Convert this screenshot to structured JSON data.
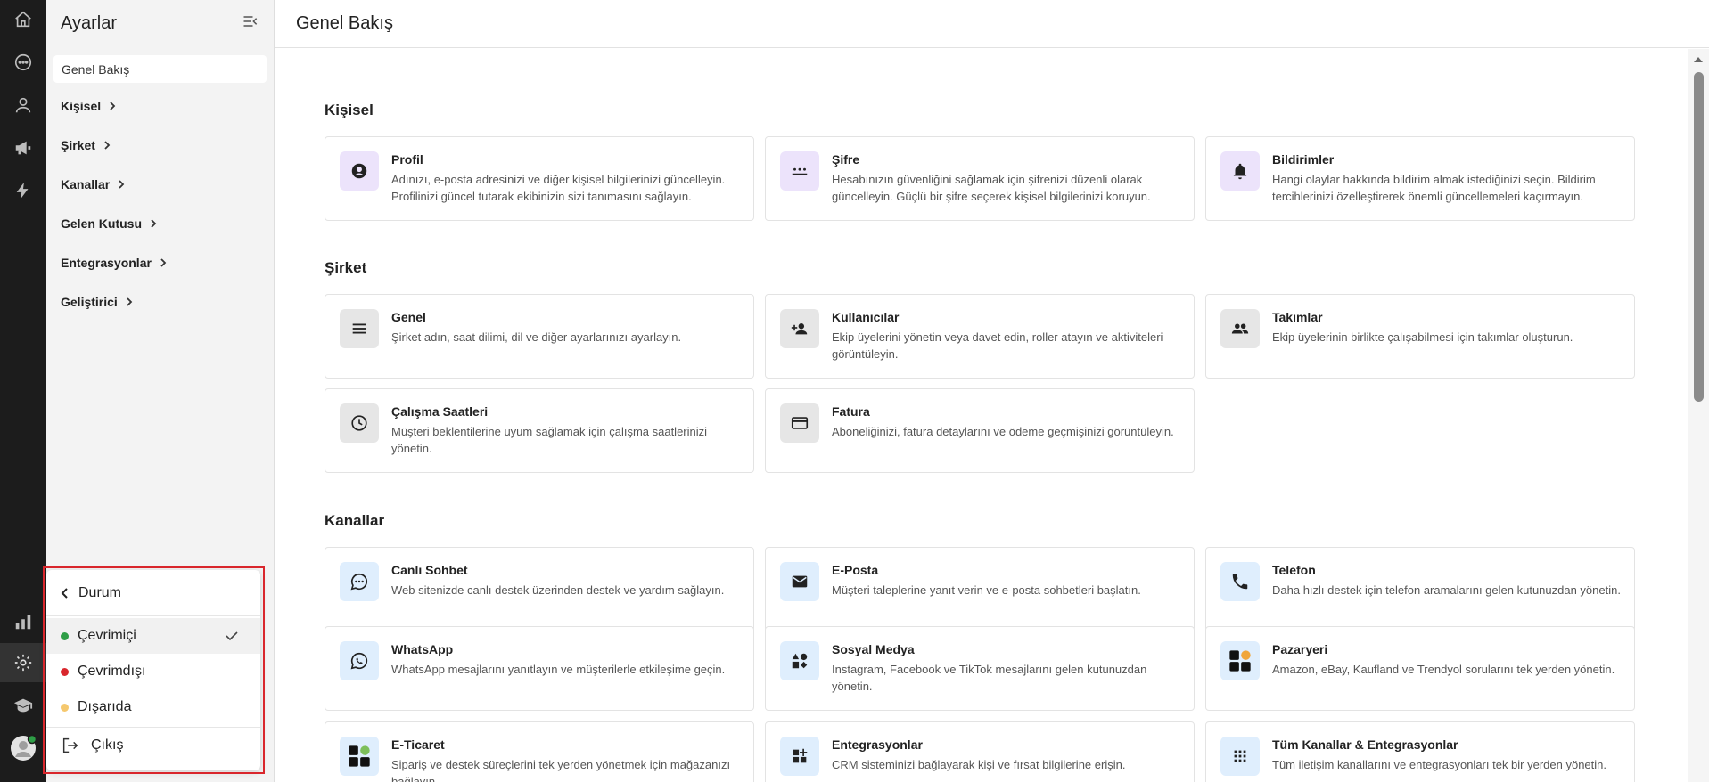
{
  "colors": {
    "rail_bg": "#1c1c1c",
    "purple_tint": "#ece3fb",
    "gray_tint": "#e6e6e6",
    "blue_tint": "#dfeefd",
    "online": "#2e9e46",
    "offline": "#d9262c",
    "away": "#f5c86e",
    "highlight_border": "#d9262c"
  },
  "rail": {
    "icons": [
      "home-icon",
      "chat-bubble-icon",
      "person-icon",
      "megaphone-icon",
      "lightning-icon",
      "bar-chart-icon",
      "gear-icon",
      "graduation-cap-icon",
      "avatar-icon"
    ]
  },
  "sidebar": {
    "title": "Ayarlar",
    "active_item": "Genel Bakış",
    "items": [
      {
        "label": "Kişisel"
      },
      {
        "label": "Şirket"
      },
      {
        "label": "Kanallar"
      },
      {
        "label": "Gelen Kutusu"
      },
      {
        "label": "Entegrasyonlar"
      },
      {
        "label": "Geliştirici"
      }
    ]
  },
  "status_menu": {
    "header": "Durum",
    "options": [
      {
        "label": "Çevrimiçi",
        "selected": true
      },
      {
        "label": "Çevrimdışı",
        "selected": false
      },
      {
        "label": "Dışarıda",
        "selected": false
      }
    ],
    "exit": "Çıkış"
  },
  "header": {
    "title": "Genel Bakış"
  },
  "sections": [
    {
      "title": "Kişisel",
      "cards": [
        {
          "title": "Profil",
          "desc": "Adınızı, e-posta adresinizi ve diğer kişisel bilgilerinizi güncelleyin. Profilinizi güncel tutarak ekibinizin sizi tanımasını sağlayın.",
          "icon": "account-circle-icon",
          "tint": "purple"
        },
        {
          "title": "Şifre",
          "desc": "Hesabınızın güvenliğini sağlamak için şifrenizi düzenli olarak güncelleyin. Güçlü bir şifre seçerek kişisel bilgilerinizi koruyun.",
          "icon": "password-icon",
          "tint": "purple"
        },
        {
          "title": "Bildirimler",
          "desc": "Hangi olaylar hakkında bildirim almak istediğinizi seçin. Bildirim tercihlerinizi özelleştirerek önemli güncellemeleri kaçırmayın.",
          "icon": "bell-icon",
          "tint": "purple"
        }
      ]
    },
    {
      "title": "Şirket",
      "cards": [
        {
          "title": "Genel",
          "desc": "Şirket adın, saat dilimi, dil ve diğer ayarlarınızı ayarlayın.",
          "icon": "menu-lines-icon",
          "tint": "gray"
        },
        {
          "title": "Kullanıcılar",
          "desc": "Ekip üyelerini yönetin veya davet edin, roller atayın ve aktiviteleri görüntüleyin.",
          "icon": "person-add-icon",
          "tint": "gray"
        },
        {
          "title": "Takımlar",
          "desc": "Ekip üyelerinin birlikte çalışabilmesi için takımlar oluşturun.",
          "icon": "group-icon",
          "tint": "gray"
        },
        {
          "title": "Çalışma Saatleri",
          "desc": "Müşteri beklentilerine uyum sağlamak için çalışma saatlerinizi yönetin.",
          "icon": "clock-icon",
          "tint": "gray"
        },
        {
          "title": "Fatura",
          "desc": "Aboneliğinizi, fatura detaylarını ve ödeme geçmişinizi görüntüleyin.",
          "icon": "credit-card-icon",
          "tint": "gray"
        }
      ]
    },
    {
      "title": "Kanallar",
      "cards": [
        {
          "title": "Canlı Sohbet",
          "desc": "Web sitenizde canlı destek üzerinden destek ve yardım sağlayın.",
          "icon": "chat-icon",
          "tint": "blue"
        },
        {
          "title": "E-Posta",
          "desc": "Müşteri taleplerine yanıt verin ve e-posta sohbetleri başlatın.",
          "icon": "mail-icon",
          "tint": "blue"
        },
        {
          "title": "Telefon",
          "desc": "Daha hızlı destek için telefon aramalarını gelen kutunuzdan yönetin.",
          "icon": "phone-icon",
          "tint": "blue"
        },
        {
          "title": "WhatsApp",
          "desc": "WhatsApp mesajlarını yanıtlayın ve müşterilerle etkileşime geçin.",
          "icon": "whatsapp-icon",
          "tint": "blue"
        },
        {
          "title": "Sosyal Medya",
          "desc": "Instagram, Facebook ve TikTok mesajlarını gelen kutunuzdan yönetin.",
          "icon": "shapes-icon",
          "tint": "blue"
        },
        {
          "title": "Pazaryeri",
          "desc": "Amazon, eBay, Kaufland ve Trendyol sorularını tek yerden yönetin.",
          "icon": "marketplace-icon",
          "tint": "blue"
        },
        {
          "title": "E-Ticaret",
          "desc": "Sipariş ve destek süreçlerini tek yerden yönetmek için mağazanızı bağlayın.",
          "icon": "ecommerce-icon",
          "tint": "blue"
        },
        {
          "title": "Entegrasyonlar",
          "desc": "CRM sisteminizi bağlayarak kişi ve fırsat bilgilerine erişin.",
          "icon": "widgets-add-icon",
          "tint": "blue"
        },
        {
          "title": "Tüm Kanallar & Entegrasyonlar",
          "desc": "Tüm iletişim kanallarını ve entegrasyonları tek bir yerden yönetin.",
          "icon": "apps-grid-icon",
          "tint": "blue"
        }
      ]
    }
  ]
}
